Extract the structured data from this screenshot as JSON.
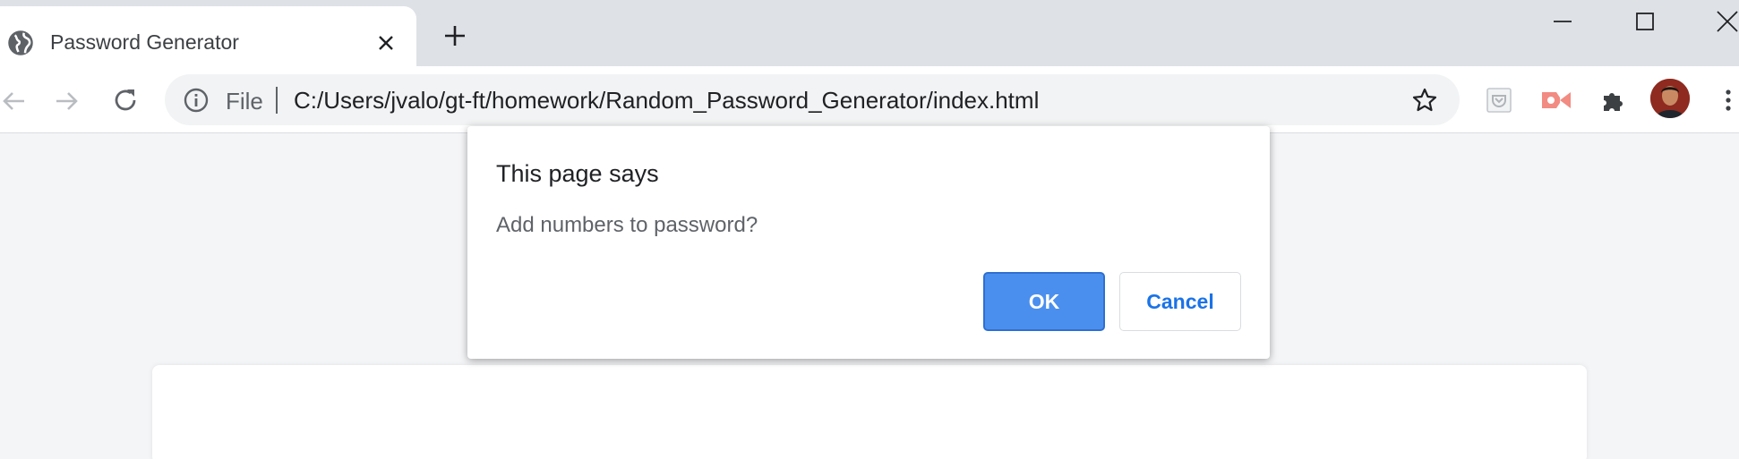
{
  "tab": {
    "title": "Password Generator",
    "favicon": "globe-icon",
    "close_icon": "close-icon"
  },
  "tabstrip": {
    "new_tab_icon": "plus-icon"
  },
  "window_controls": {
    "minimize_icon": "minimize-icon",
    "maximize_icon": "maximize-icon",
    "close_icon": "close-icon"
  },
  "toolbar": {
    "back_icon": "back-arrow-icon",
    "forward_icon": "forward-arrow-icon",
    "reload_icon": "reload-icon",
    "omnibox": {
      "security_icon": "info-icon",
      "scheme_label": "File",
      "url": "C:/Users/jvalo/gt-ft/homework/Random_Password_Generator/index.html",
      "bookmark_icon": "star-icon"
    },
    "extensions": [
      "pocket-icon",
      "screencast-icon",
      "puzzle-icon"
    ],
    "profile_icon": "avatar",
    "menu_icon": "kebab-menu-icon"
  },
  "dialog": {
    "title": "This page says",
    "message": "Add numbers to password?",
    "ok_label": "OK",
    "cancel_label": "Cancel"
  },
  "colors": {
    "tabstrip_bg": "#dee1e6",
    "omnibox_bg": "#f1f3f4",
    "page_bg": "#f4f5f7",
    "ok_button_bg": "#4a8fee",
    "cancel_text": "#1a73e8",
    "screencast_icon": "#f28b82"
  }
}
